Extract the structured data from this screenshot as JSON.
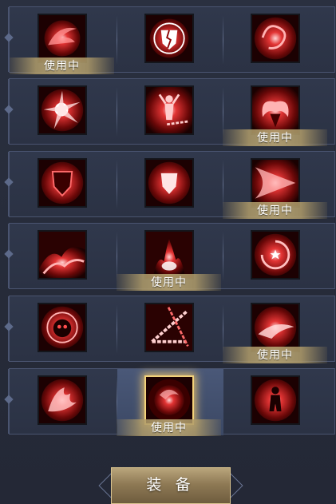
{
  "in_use_label": "使用中",
  "equip_button": "装 备",
  "rows": [
    {
      "slots": [
        {
          "icon": "red-feather-burst-icon",
          "in_use": true,
          "selected": false
        },
        {
          "icon": "broken-shield-icon",
          "in_use": false,
          "selected": false
        },
        {
          "icon": "red-flame-swirl-icon",
          "in_use": false,
          "selected": false
        }
      ]
    },
    {
      "slots": [
        {
          "icon": "red-energy-burst-icon",
          "in_use": false,
          "selected": false
        },
        {
          "icon": "chained-figure-icon",
          "in_use": false,
          "selected": false
        },
        {
          "icon": "demon-horns-icon",
          "in_use": true,
          "selected": false
        }
      ]
    },
    {
      "slots": [
        {
          "icon": "red-shield-icon",
          "in_use": false,
          "selected": false
        },
        {
          "icon": "glowing-shield-icon",
          "in_use": false,
          "selected": false
        },
        {
          "icon": "red-wing-slash-icon",
          "in_use": true,
          "selected": false
        }
      ]
    },
    {
      "slots": [
        {
          "icon": "fire-wave-icon",
          "in_use": false,
          "selected": false
        },
        {
          "icon": "fire-eruption-icon",
          "in_use": true,
          "selected": false
        },
        {
          "icon": "vortex-core-icon",
          "in_use": false,
          "selected": false
        }
      ]
    },
    {
      "slots": [
        {
          "icon": "skull-aura-icon",
          "in_use": false,
          "selected": false
        },
        {
          "icon": "chain-triangle-icon",
          "in_use": false,
          "selected": false
        },
        {
          "icon": "flame-blast-icon",
          "in_use": true,
          "selected": false
        }
      ]
    },
    {
      "slots": [
        {
          "icon": "phoenix-flame-icon",
          "in_use": false,
          "selected": false
        },
        {
          "icon": "red-orb-icon",
          "in_use": true,
          "selected": true
        },
        {
          "icon": "burning-figure-icon",
          "in_use": false,
          "selected": false
        }
      ]
    }
  ]
}
